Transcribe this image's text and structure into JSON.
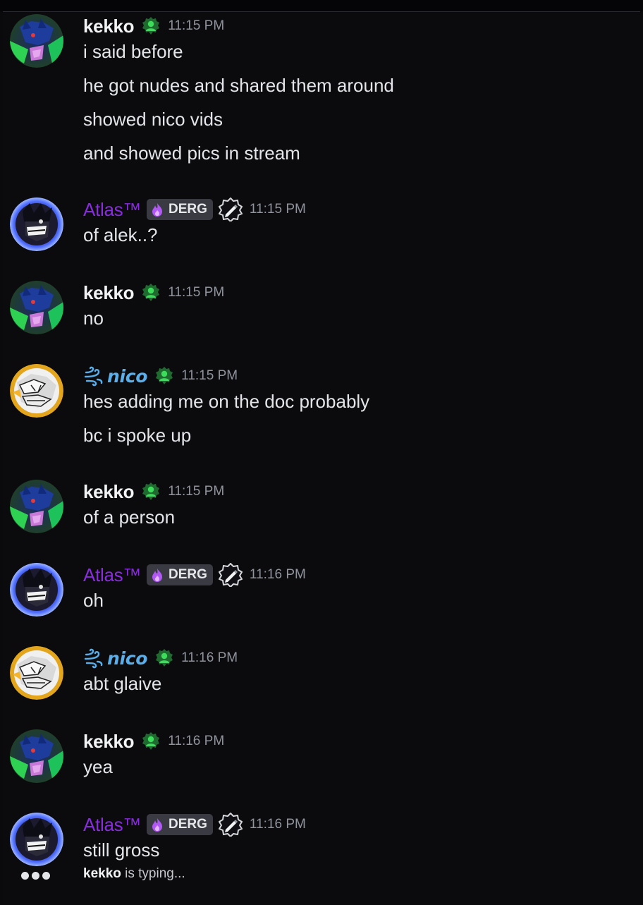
{
  "colors": {
    "background": "#0b0b0e",
    "kekko_name": "#f2f3f5",
    "atlas_name": "#8a2be2",
    "nico_name": "#5aaeea",
    "role_icon_green": "#3ddc5b",
    "timestamp": "#8f939b"
  },
  "messages": [
    {
      "author": "kekko",
      "role_icon": "green-person-icon",
      "time": "11:15 PM",
      "lines": [
        "i said before",
        "he got nudes and shared them around",
        "showed nico vids",
        "and showed pics in stream"
      ]
    },
    {
      "author": "Atlas™",
      "tag": "DERG",
      "tag_icon": "purple-flame-icon",
      "badge": "pen-badge-icon",
      "time": "11:15 PM",
      "lines": [
        "of alek..?"
      ]
    },
    {
      "author": "kekko",
      "role_icon": "green-person-icon",
      "time": "11:15 PM",
      "lines": [
        "no"
      ]
    },
    {
      "author": "nico",
      "name_icon": "wind-swirl-icon",
      "role_icon": "green-person-icon",
      "time": "11:15 PM",
      "lines": [
        "hes adding me on the doc probably",
        "bc i spoke up"
      ]
    },
    {
      "author": "kekko",
      "role_icon": "green-person-icon",
      "time": "11:15 PM",
      "lines": [
        "of a person"
      ]
    },
    {
      "author": "Atlas™",
      "tag": "DERG",
      "tag_icon": "purple-flame-icon",
      "badge": "pen-badge-icon",
      "time": "11:16 PM",
      "lines": [
        "oh"
      ]
    },
    {
      "author": "nico",
      "name_icon": "wind-swirl-icon",
      "role_icon": "green-person-icon",
      "time": "11:16 PM",
      "lines": [
        "abt glaive"
      ]
    },
    {
      "author": "kekko",
      "role_icon": "green-person-icon",
      "time": "11:16 PM",
      "lines": [
        "yea"
      ]
    },
    {
      "author": "Atlas™",
      "tag": "DERG",
      "tag_icon": "purple-flame-icon",
      "badge": "pen-badge-icon",
      "time": "11:16 PM",
      "lines": [
        "still gross"
      ]
    }
  ],
  "typing": {
    "user": "kekko",
    "suffix": " is typing..."
  }
}
